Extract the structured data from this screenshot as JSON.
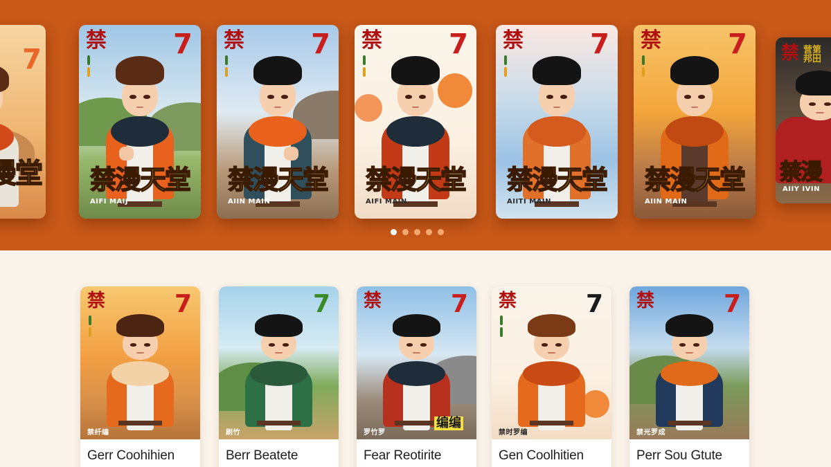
{
  "banner": {
    "background": "#c75818",
    "cards": [
      {
        "kanji": "",
        "number": "7",
        "number_color": "#e8682a",
        "title": "漫堂",
        "label": "",
        "sky": "#f0c98e",
        "jacket": "#e8e4da",
        "hair": "#5a2c16",
        "corner": ""
      },
      {
        "kanji": "禁",
        "number": "7",
        "number_color": "#c81e1e",
        "title": "禁漫天堂",
        "label": "AIFI MAIJ",
        "sky": "#9fc6e6",
        "jacket": "#e8621e",
        "hair": "#5a2c16",
        "corner": ""
      },
      {
        "kanji": "禁",
        "number": "7",
        "number_color": "#c81e1e",
        "title": "禁漫天堂",
        "label": "AIIN MAIN",
        "sky": "#a7c9e9",
        "jacket": "#2f4f5c",
        "hair": "#141414",
        "corner": ""
      },
      {
        "kanji": "禁",
        "number": "7",
        "number_color": "#c81e1e",
        "title": "禁漫天堂",
        "label": "AIFI MAIN",
        "sky": "#fbf5ea",
        "jacket": "#c33b16",
        "hair": "#141414",
        "corner": ""
      },
      {
        "kanji": "禁",
        "number": "7",
        "number_color": "#c81e1e",
        "title": "禁漫天堂",
        "label": "AIITI MAIN",
        "sky": "#c8dbe9",
        "jacket": "#e0702a",
        "hair": "#141414",
        "corner": ""
      },
      {
        "kanji": "禁",
        "number": "7",
        "number_color": "#c81e1e",
        "title": "禁漫天堂",
        "label": "AIIN MAIN",
        "sky": "#f3a53a",
        "jacket": "#e06a18",
        "hair": "#141414",
        "corner": ""
      },
      {
        "kanji": "禁",
        "number": "",
        "number_color": "#c81e1e",
        "title": "禁漫",
        "label": "AIIY IVIN",
        "sky": "#2a2a2a",
        "jacket": "#b02020",
        "hair": "#141414",
        "corner": "营第 邦田"
      }
    ],
    "dots_active": 0,
    "dots_count": 5
  },
  "grid": {
    "cards": [
      {
        "kanji": "禁",
        "number": "7",
        "number_color": "#c81e1e",
        "title": "Gerr Coohihien",
        "label": "禁纤编",
        "sky": "#f3a043",
        "jacket": "#e56a1e",
        "hair": "#4b2412",
        "stamp": ""
      },
      {
        "kanji": "",
        "number": "7",
        "number_color": "#3a8a2a",
        "title": "Berr Beatete",
        "label": "刷竹",
        "sky": "#a6d2ea",
        "jacket": "#2e7046",
        "hair": "#141414",
        "stamp": ""
      },
      {
        "kanji": "禁",
        "number": "7",
        "number_color": "#c81e1e",
        "title": "Fear Reotirite",
        "label": "罗竹罗",
        "sky": "#8fbfe6",
        "jacket": "#b8301e",
        "hair": "#141414",
        "stamp": "编编"
      },
      {
        "kanji": "禁",
        "number": "7",
        "number_color": "#1b1b1b",
        "title": "Gen Coolhitien",
        "label": "禁时罗编",
        "sky": "#fbf4ea",
        "jacket": "#e56a1e",
        "hair": "#7a3a16",
        "stamp": ""
      },
      {
        "kanji": "禁",
        "number": "7",
        "number_color": "#c81e1e",
        "title": "Perr Sou Gtute",
        "label": "禁光罗成",
        "sky": "#6fa6dc",
        "jacket": "#213a5c",
        "hair": "#141414",
        "stamp": ""
      }
    ]
  }
}
